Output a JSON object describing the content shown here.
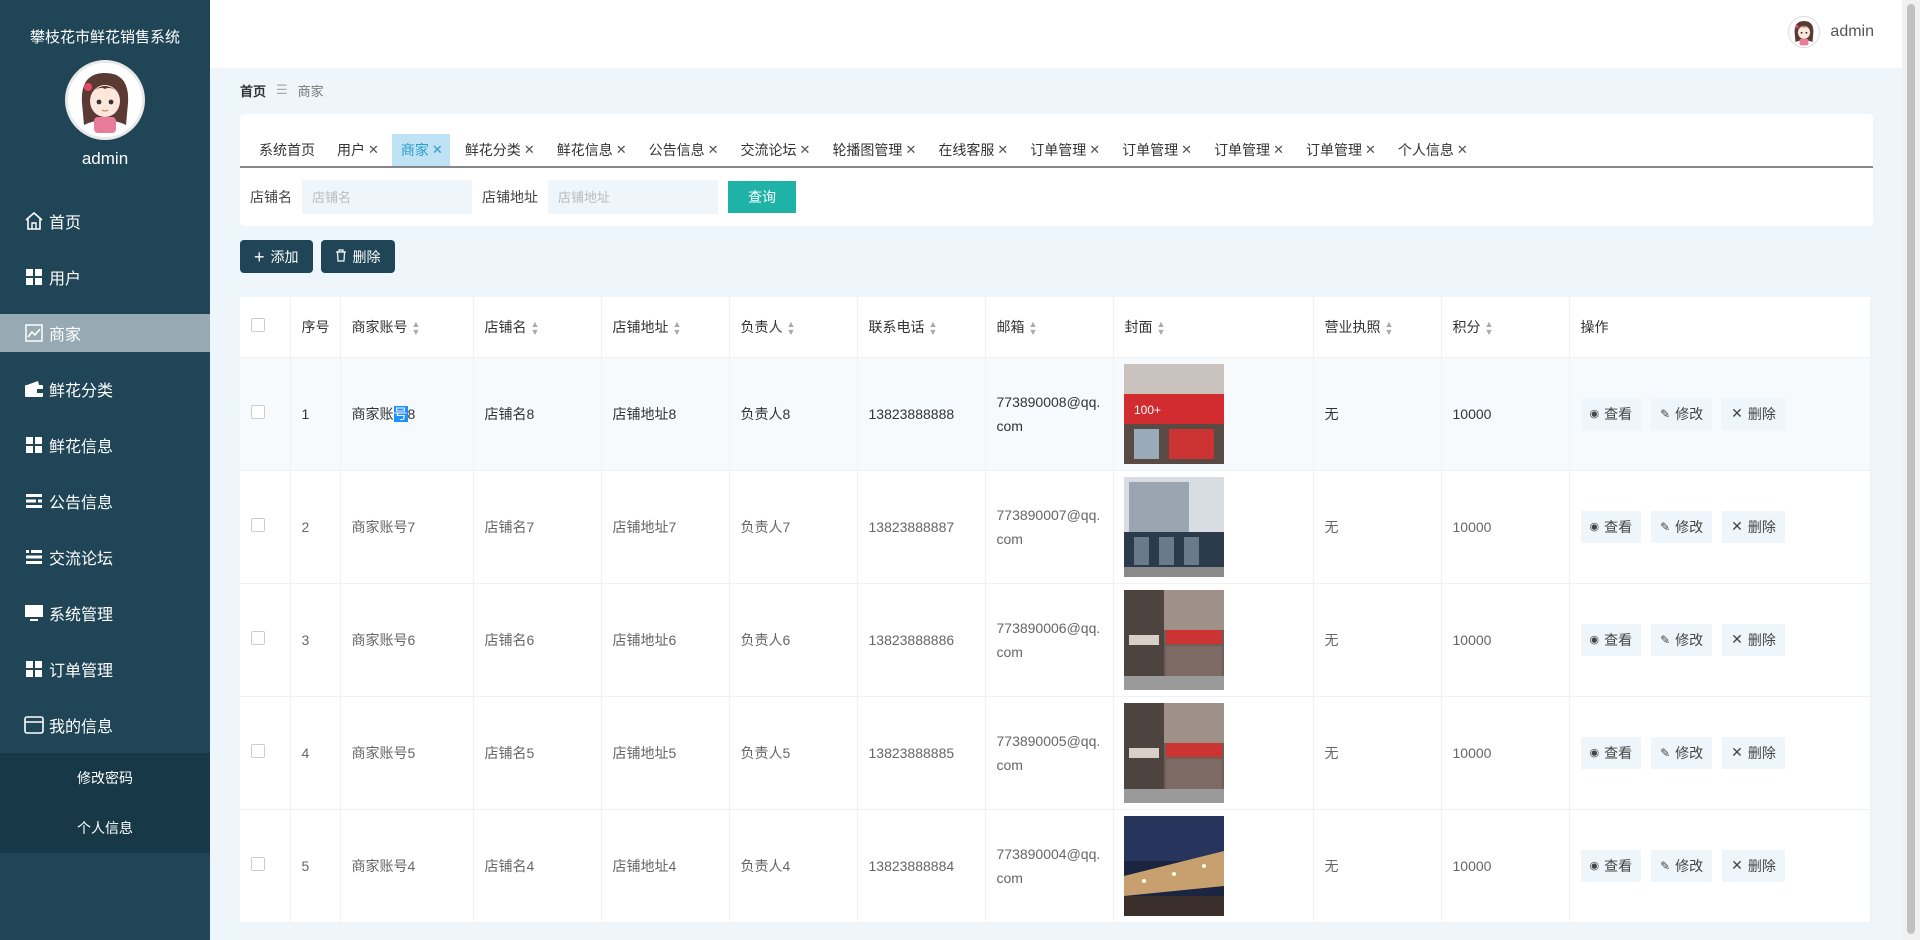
{
  "app": {
    "title": "攀枝花市鲜花销售系统"
  },
  "user": {
    "name": "admin"
  },
  "sidebar": {
    "items": [
      {
        "label": "首页",
        "icon": "home-icon"
      },
      {
        "label": "用户",
        "icon": "grid-icon"
      },
      {
        "label": "商家",
        "icon": "chart-icon",
        "active": true
      },
      {
        "label": "鲜花分类",
        "icon": "wallet-icon"
      },
      {
        "label": "鲜花信息",
        "icon": "grid-icon"
      },
      {
        "label": "公告信息",
        "icon": "list-icon"
      },
      {
        "label": "交流论坛",
        "icon": "list-icon"
      },
      {
        "label": "系统管理",
        "icon": "monitor-icon"
      },
      {
        "label": "订单管理",
        "icon": "grid-icon"
      },
      {
        "label": "我的信息",
        "icon": "card-icon"
      }
    ],
    "submenu": [
      "修改密码",
      "个人信息"
    ]
  },
  "breadcrumb": {
    "home": "首页",
    "current": "商家"
  },
  "tabs": [
    {
      "label": "系统首页",
      "closable": false
    },
    {
      "label": "用户",
      "closable": true
    },
    {
      "label": "商家",
      "closable": true,
      "active": true
    },
    {
      "label": "鲜花分类",
      "closable": true
    },
    {
      "label": "鲜花信息",
      "closable": true
    },
    {
      "label": "公告信息",
      "closable": true
    },
    {
      "label": "交流论坛",
      "closable": true
    },
    {
      "label": "轮播图管理",
      "closable": true
    },
    {
      "label": "在线客服",
      "closable": true
    },
    {
      "label": "订单管理",
      "closable": true
    },
    {
      "label": "订单管理",
      "closable": true
    },
    {
      "label": "订单管理",
      "closable": true
    },
    {
      "label": "订单管理",
      "closable": true
    },
    {
      "label": "个人信息",
      "closable": true
    }
  ],
  "search": {
    "shop_name_label": "店铺名",
    "shop_name_placeholder": "店铺名",
    "shop_addr_label": "店铺地址",
    "shop_addr_placeholder": "店铺地址",
    "query_label": "查询"
  },
  "actions": {
    "add_label": "添加",
    "delete_label": "删除"
  },
  "table": {
    "columns": [
      "序号",
      "商家账号",
      "店铺名",
      "店铺地址",
      "负责人",
      "联系电话",
      "邮箱",
      "封面",
      "营业执照",
      "积分",
      "操作"
    ],
    "ops": {
      "view": "查看",
      "edit": "修改",
      "delete": "删除"
    },
    "rows": [
      {
        "index": "1",
        "account_pre": "商家账",
        "account_hl": "号",
        "account_post": "8",
        "shop": "店铺名8",
        "addr": "店铺地址8",
        "manager": "负责人8",
        "phone": "13823888888",
        "email": "773890008@qq.com",
        "license": "无",
        "points": "10000",
        "cover_scene": "storefront-red"
      },
      {
        "index": "2",
        "account": "商家账号7",
        "shop": "店铺名7",
        "addr": "店铺地址7",
        "manager": "负责人7",
        "phone": "13823888887",
        "email": "773890007@qq.com",
        "license": "无",
        "points": "10000",
        "cover_scene": "building-blue"
      },
      {
        "index": "3",
        "account": "商家账号6",
        "shop": "店铺名6",
        "addr": "店铺地址6",
        "manager": "负责人6",
        "phone": "13823888886",
        "email": "773890006@qq.com",
        "license": "无",
        "points": "10000",
        "cover_scene": "street-shops"
      },
      {
        "index": "4",
        "account": "商家账号5",
        "shop": "店铺名5",
        "addr": "店铺地址5",
        "manager": "负责人5",
        "phone": "13823888885",
        "email": "773890005@qq.com",
        "license": "无",
        "points": "10000",
        "cover_scene": "street-shops"
      },
      {
        "index": "5",
        "account": "商家账号4",
        "shop": "店铺名4",
        "addr": "店铺地址4",
        "manager": "负责人4",
        "phone": "13823888884",
        "email": "773890004@qq.com",
        "license": "无",
        "points": "10000",
        "cover_scene": "night-mall"
      }
    ]
  },
  "colors": {
    "sidebar": "#1f4556",
    "accent": "#1fb3a8",
    "active_tab": "#2b9ccf"
  }
}
